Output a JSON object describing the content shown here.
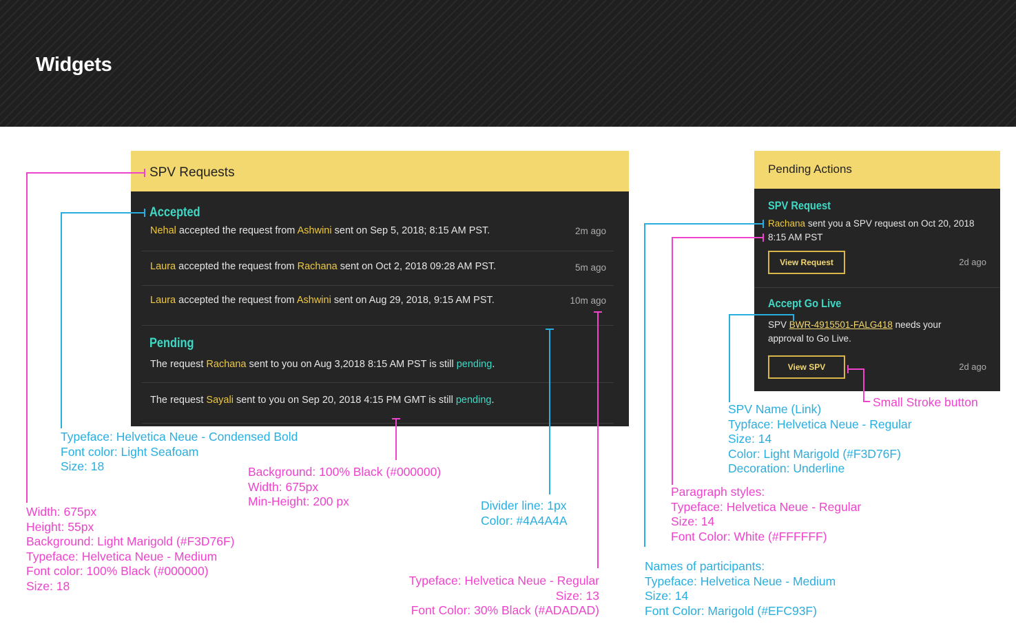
{
  "page": {
    "title": "Widgets"
  },
  "spv_requests": {
    "title": "SPV Requests",
    "accepted_title": "Accepted",
    "accepted": [
      {
        "name1": "Nehal",
        "mid": "accepted the request from",
        "name2": "Ashwini",
        "tail": "sent on Sep 5, 2018; 8:15 AM PST.",
        "ago": "2m ago"
      },
      {
        "name1": "Laura",
        "mid": "accepted the request from",
        "name2": "Rachana",
        "tail": "sent on Oct 2, 2018 09:28 AM PST.",
        "ago": "5m ago"
      },
      {
        "name1": "Laura",
        "mid": "accepted the request from",
        "name2": "Ashwini",
        "tail": "sent on Aug 29, 2018, 9:15 AM PST.",
        "ago": "10m ago"
      }
    ],
    "pending_title": "Pending",
    "pending": [
      {
        "pre": "The request",
        "name": "Rachana",
        "tail": "sent to you on Aug 3,2018 8:15 AM PST is still",
        "status": "pending",
        "end": "."
      },
      {
        "pre": "The request",
        "name": "Sayali",
        "tail": "sent to you on Sep 20, 2018 4:15 PM GMT is still",
        "status": "pending",
        "end": "."
      }
    ]
  },
  "pending_actions": {
    "title": "Pending Actions",
    "spv_request": {
      "title": "SPV Request",
      "name": "Rachana",
      "line1": "sent you a SPV request on Oct 20, 2018",
      "line2": "8:15 AM PST",
      "button": "View Request",
      "ago": "2d ago"
    },
    "accept_go_live": {
      "title": "Accept Go Live",
      "pre": "SPV",
      "link": "BWR-4915501-FALG418",
      "post": "needs your",
      "line2": "approval to Go Live.",
      "button": "View SPV",
      "ago": "2d ago"
    }
  },
  "annotations": {
    "section_title_spec": [
      "Typeface: Helvetica Neue - Condensed Bold",
      "Font color: Light Seafoam",
      "Size: 18"
    ],
    "header_spec": [
      "Width: 675px",
      "Height: 55px",
      "Background: Light Marigold (#F3D76F)",
      "Typeface: Helvetica Neue - Medium",
      "Font color: 100% Black (#000000)",
      "Size: 18"
    ],
    "background_spec": [
      "Background: 100% Black (#000000)",
      "Width: 675px",
      "Min-Height: 200 px"
    ],
    "divider_spec": [
      "Divider line: 1px",
      "Color: #4A4A4A"
    ],
    "timestamp_spec": [
      "Typeface: Helvetica Neue - Regular",
      "Size: 13",
      "Font Color: 30% Black (#ADADAD)"
    ],
    "spv_link_spec": [
      "SPV Name (Link)",
      "Typface: Helvetica Neue - Regular",
      "Size: 14",
      "Color: Light Marigold (#F3D76F)",
      "Decoration: Underline"
    ],
    "small_stroke_button": "Small Stroke button",
    "paragraph_spec": [
      "Paragraph styles:",
      "Typeface: Helvetica Neue - Regular",
      "Size: 14",
      "Font Color: White (#FFFFFF)"
    ],
    "participants_spec": [
      "Names of participants:",
      "Typeface: Helvetica Neue - Medium",
      "Size: 14",
      "Font Color: Marigold (#EFC93F)"
    ]
  },
  "colors": {
    "marigold_light": "#F3D76F",
    "marigold": "#EFC93F",
    "seafoam": "#3FD9C5",
    "timestamp_grey": "#ADADAD",
    "annotation_pink": "#ee44cc",
    "annotation_blue": "#29aee0"
  }
}
